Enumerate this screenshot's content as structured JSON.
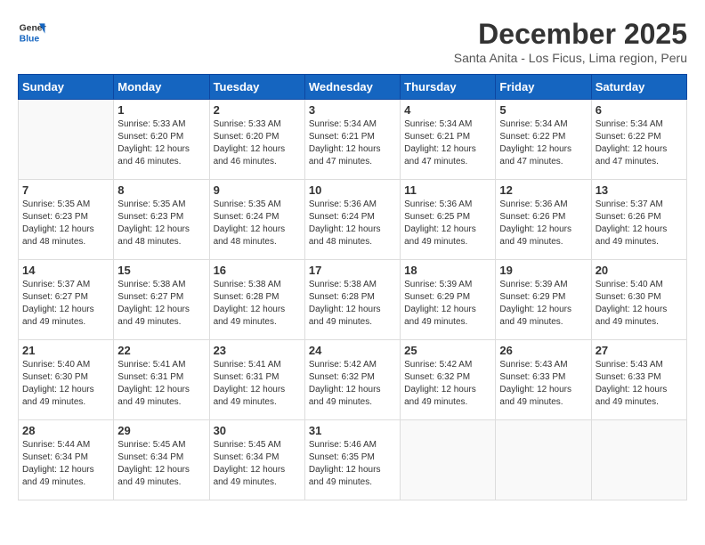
{
  "logo": {
    "line1": "General",
    "line2": "Blue"
  },
  "title": "December 2025",
  "subtitle": "Santa Anita - Los Ficus, Lima region, Peru",
  "days_of_week": [
    "Sunday",
    "Monday",
    "Tuesday",
    "Wednesday",
    "Thursday",
    "Friday",
    "Saturday"
  ],
  "weeks": [
    [
      {
        "day": "",
        "info": ""
      },
      {
        "day": "1",
        "info": "Sunrise: 5:33 AM\nSunset: 6:20 PM\nDaylight: 12 hours\nand 46 minutes."
      },
      {
        "day": "2",
        "info": "Sunrise: 5:33 AM\nSunset: 6:20 PM\nDaylight: 12 hours\nand 46 minutes."
      },
      {
        "day": "3",
        "info": "Sunrise: 5:34 AM\nSunset: 6:21 PM\nDaylight: 12 hours\nand 47 minutes."
      },
      {
        "day": "4",
        "info": "Sunrise: 5:34 AM\nSunset: 6:21 PM\nDaylight: 12 hours\nand 47 minutes."
      },
      {
        "day": "5",
        "info": "Sunrise: 5:34 AM\nSunset: 6:22 PM\nDaylight: 12 hours\nand 47 minutes."
      },
      {
        "day": "6",
        "info": "Sunrise: 5:34 AM\nSunset: 6:22 PM\nDaylight: 12 hours\nand 47 minutes."
      }
    ],
    [
      {
        "day": "7",
        "info": "Sunrise: 5:35 AM\nSunset: 6:23 PM\nDaylight: 12 hours\nand 48 minutes."
      },
      {
        "day": "8",
        "info": "Sunrise: 5:35 AM\nSunset: 6:23 PM\nDaylight: 12 hours\nand 48 minutes."
      },
      {
        "day": "9",
        "info": "Sunrise: 5:35 AM\nSunset: 6:24 PM\nDaylight: 12 hours\nand 48 minutes."
      },
      {
        "day": "10",
        "info": "Sunrise: 5:36 AM\nSunset: 6:24 PM\nDaylight: 12 hours\nand 48 minutes."
      },
      {
        "day": "11",
        "info": "Sunrise: 5:36 AM\nSunset: 6:25 PM\nDaylight: 12 hours\nand 49 minutes."
      },
      {
        "day": "12",
        "info": "Sunrise: 5:36 AM\nSunset: 6:26 PM\nDaylight: 12 hours\nand 49 minutes."
      },
      {
        "day": "13",
        "info": "Sunrise: 5:37 AM\nSunset: 6:26 PM\nDaylight: 12 hours\nand 49 minutes."
      }
    ],
    [
      {
        "day": "14",
        "info": "Sunrise: 5:37 AM\nSunset: 6:27 PM\nDaylight: 12 hours\nand 49 minutes."
      },
      {
        "day": "15",
        "info": "Sunrise: 5:38 AM\nSunset: 6:27 PM\nDaylight: 12 hours\nand 49 minutes."
      },
      {
        "day": "16",
        "info": "Sunrise: 5:38 AM\nSunset: 6:28 PM\nDaylight: 12 hours\nand 49 minutes."
      },
      {
        "day": "17",
        "info": "Sunrise: 5:38 AM\nSunset: 6:28 PM\nDaylight: 12 hours\nand 49 minutes."
      },
      {
        "day": "18",
        "info": "Sunrise: 5:39 AM\nSunset: 6:29 PM\nDaylight: 12 hours\nand 49 minutes."
      },
      {
        "day": "19",
        "info": "Sunrise: 5:39 AM\nSunset: 6:29 PM\nDaylight: 12 hours\nand 49 minutes."
      },
      {
        "day": "20",
        "info": "Sunrise: 5:40 AM\nSunset: 6:30 PM\nDaylight: 12 hours\nand 49 minutes."
      }
    ],
    [
      {
        "day": "21",
        "info": "Sunrise: 5:40 AM\nSunset: 6:30 PM\nDaylight: 12 hours\nand 49 minutes."
      },
      {
        "day": "22",
        "info": "Sunrise: 5:41 AM\nSunset: 6:31 PM\nDaylight: 12 hours\nand 49 minutes."
      },
      {
        "day": "23",
        "info": "Sunrise: 5:41 AM\nSunset: 6:31 PM\nDaylight: 12 hours\nand 49 minutes."
      },
      {
        "day": "24",
        "info": "Sunrise: 5:42 AM\nSunset: 6:32 PM\nDaylight: 12 hours\nand 49 minutes."
      },
      {
        "day": "25",
        "info": "Sunrise: 5:42 AM\nSunset: 6:32 PM\nDaylight: 12 hours\nand 49 minutes."
      },
      {
        "day": "26",
        "info": "Sunrise: 5:43 AM\nSunset: 6:33 PM\nDaylight: 12 hours\nand 49 minutes."
      },
      {
        "day": "27",
        "info": "Sunrise: 5:43 AM\nSunset: 6:33 PM\nDaylight: 12 hours\nand 49 minutes."
      }
    ],
    [
      {
        "day": "28",
        "info": "Sunrise: 5:44 AM\nSunset: 6:34 PM\nDaylight: 12 hours\nand 49 minutes."
      },
      {
        "day": "29",
        "info": "Sunrise: 5:45 AM\nSunset: 6:34 PM\nDaylight: 12 hours\nand 49 minutes."
      },
      {
        "day": "30",
        "info": "Sunrise: 5:45 AM\nSunset: 6:34 PM\nDaylight: 12 hours\nand 49 minutes."
      },
      {
        "day": "31",
        "info": "Sunrise: 5:46 AM\nSunset: 6:35 PM\nDaylight: 12 hours\nand 49 minutes."
      },
      {
        "day": "",
        "info": ""
      },
      {
        "day": "",
        "info": ""
      },
      {
        "day": "",
        "info": ""
      }
    ]
  ]
}
